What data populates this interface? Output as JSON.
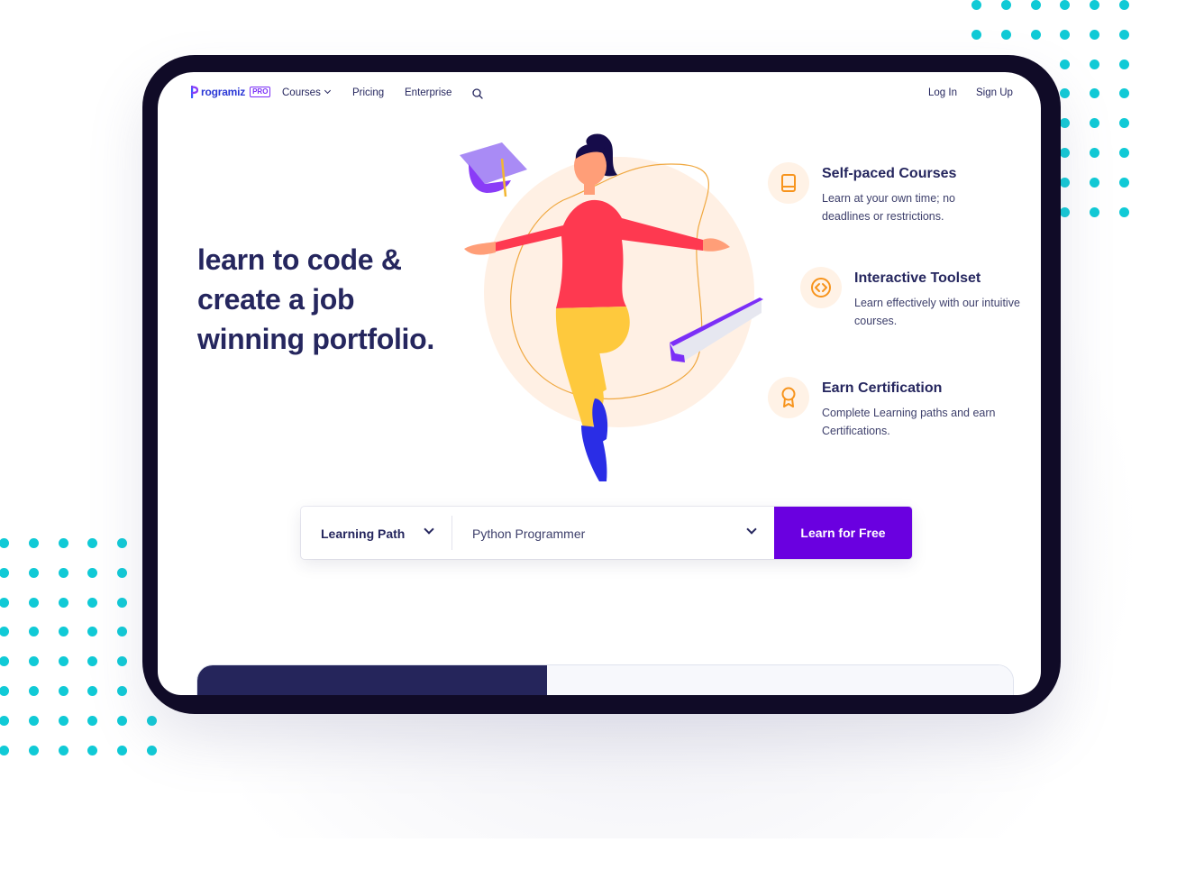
{
  "nav": {
    "logo_text": "rogramiz",
    "logo_badge": "PRO",
    "items": [
      {
        "label": "Courses",
        "has_dropdown": true
      },
      {
        "label": "Pricing"
      },
      {
        "label": "Enterprise"
      }
    ],
    "search_icon": "search-icon",
    "login_label": "Log In",
    "signup_label": "Sign Up"
  },
  "hero": {
    "title_line1": "learn to code &",
    "title_line2": "create a job",
    "title_line3": "winning portfolio."
  },
  "features": [
    {
      "icon": "book-icon",
      "title": "Self-paced Courses",
      "description": "Learn at your own time; no deadlines or restrictions."
    },
    {
      "icon": "code-icon",
      "title": "Interactive Toolset",
      "description": "Learn effectively with our intuitive courses."
    },
    {
      "icon": "award-icon",
      "title": "Earn Certification",
      "description": "Complete Learning paths and earn Certifications."
    }
  ],
  "search_bar": {
    "category_label": "Learning Path",
    "selected_value": "Python Programmer",
    "cta_label": "Learn for Free"
  },
  "colors": {
    "brand_dark": "#25265e",
    "brand_purple": "#6a00e0",
    "accent_orange": "#f7941d",
    "dots_cyan": "#10cad6",
    "device_frame": "#100b27"
  }
}
